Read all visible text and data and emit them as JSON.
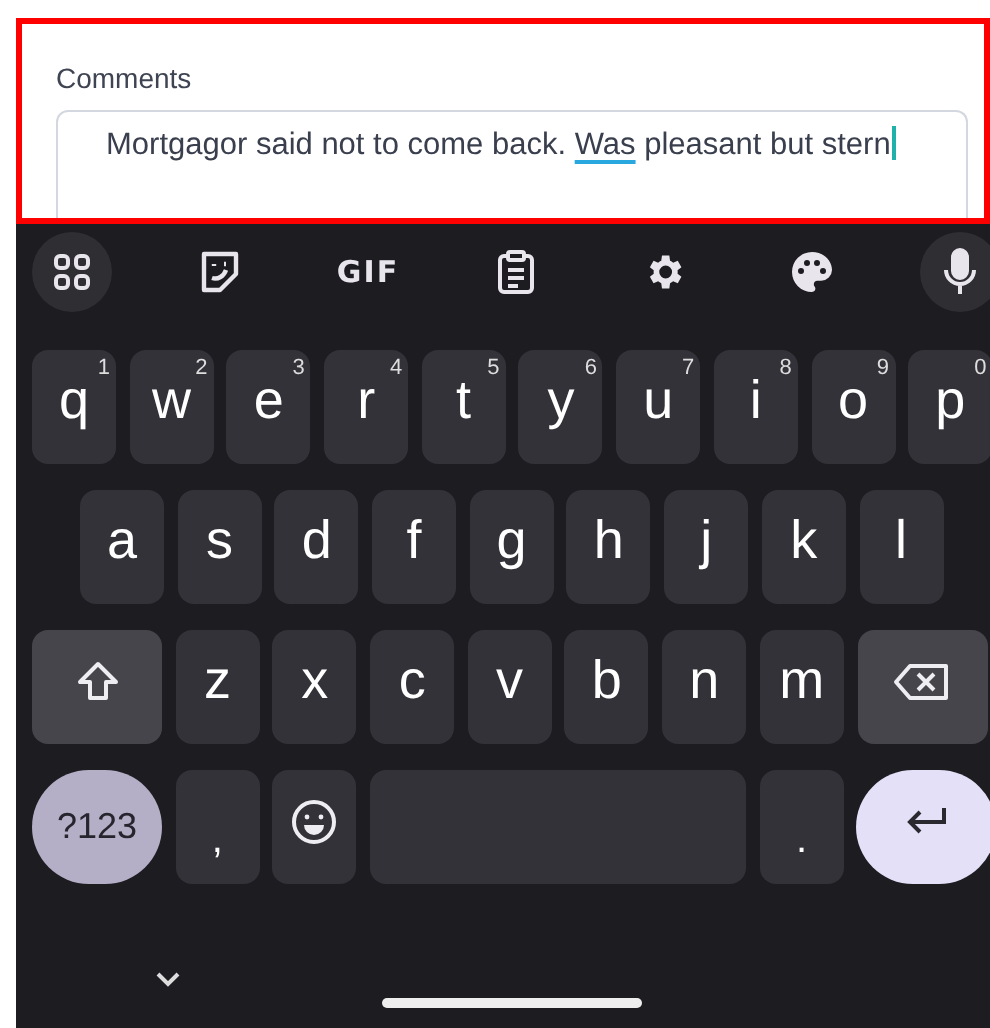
{
  "comment_field": {
    "label": "Comments",
    "highlighted": true,
    "focused": true,
    "value": [
      {
        "text": "Mortgagor said not to come back.  ",
        "flagged": false
      },
      {
        "text": "Was",
        "flagged": true
      },
      {
        "text": " pleasant but stern",
        "flagged": false
      }
    ]
  },
  "keyboard": {
    "toolbar": [
      {
        "kind": "apps"
      },
      {
        "kind": "sticker"
      },
      {
        "kind": "gif",
        "label": "GIF"
      },
      {
        "kind": "clipboard"
      },
      {
        "kind": "settings"
      },
      {
        "kind": "palette"
      },
      {
        "kind": "mic"
      }
    ],
    "rows": [
      {
        "keys": [
          {
            "kind": "letter",
            "label": "q",
            "hint": "1"
          },
          {
            "kind": "letter",
            "label": "w",
            "hint": "2"
          },
          {
            "kind": "letter",
            "label": "e",
            "hint": "3"
          },
          {
            "kind": "letter",
            "label": "r",
            "hint": "4"
          },
          {
            "kind": "letter",
            "label": "t",
            "hint": "5"
          },
          {
            "kind": "letter",
            "label": "y",
            "hint": "6"
          },
          {
            "kind": "letter",
            "label": "u",
            "hint": "7"
          },
          {
            "kind": "letter",
            "label": "i",
            "hint": "8"
          },
          {
            "kind": "letter",
            "label": "o",
            "hint": "9"
          },
          {
            "kind": "letter",
            "label": "p",
            "hint": "0"
          }
        ]
      },
      {
        "keys": [
          {
            "kind": "letter",
            "label": "a"
          },
          {
            "kind": "letter",
            "label": "s"
          },
          {
            "kind": "letter",
            "label": "d"
          },
          {
            "kind": "letter",
            "label": "f"
          },
          {
            "kind": "letter",
            "label": "g"
          },
          {
            "kind": "letter",
            "label": "h"
          },
          {
            "kind": "letter",
            "label": "j"
          },
          {
            "kind": "letter",
            "label": "k"
          },
          {
            "kind": "letter",
            "label": "l"
          }
        ]
      },
      {
        "keys": [
          {
            "kind": "shift"
          },
          {
            "kind": "letter",
            "label": "z"
          },
          {
            "kind": "letter",
            "label": "x"
          },
          {
            "kind": "letter",
            "label": "c"
          },
          {
            "kind": "letter",
            "label": "v"
          },
          {
            "kind": "letter",
            "label": "b"
          },
          {
            "kind": "letter",
            "label": "n"
          },
          {
            "kind": "letter",
            "label": "m"
          },
          {
            "kind": "backspace"
          }
        ]
      },
      {
        "keys": [
          {
            "kind": "symbols",
            "label": "?123"
          },
          {
            "kind": "punct",
            "label": ","
          },
          {
            "kind": "emoji"
          },
          {
            "kind": "space"
          },
          {
            "kind": "punct",
            "label": "."
          },
          {
            "kind": "enter"
          }
        ]
      }
    ]
  }
}
